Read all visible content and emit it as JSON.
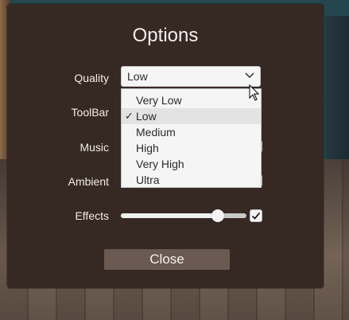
{
  "options": {
    "title": "Options",
    "quality": {
      "label": "Quality",
      "value": "Low",
      "options": [
        "Very Low",
        "Low",
        "Medium",
        "High",
        "Very High",
        "Ultra"
      ],
      "selected_index": 1
    },
    "toolbar": {
      "label": "ToolBar"
    },
    "music": {
      "label": "Music"
    },
    "ambient": {
      "label": "Ambient"
    },
    "effects": {
      "label": "Effects",
      "level": 0.77,
      "enabled": true
    },
    "close_label": "Close"
  },
  "colors": {
    "panel": "#362924",
    "button": "#6a5a51",
    "text": "#f0ece8"
  }
}
